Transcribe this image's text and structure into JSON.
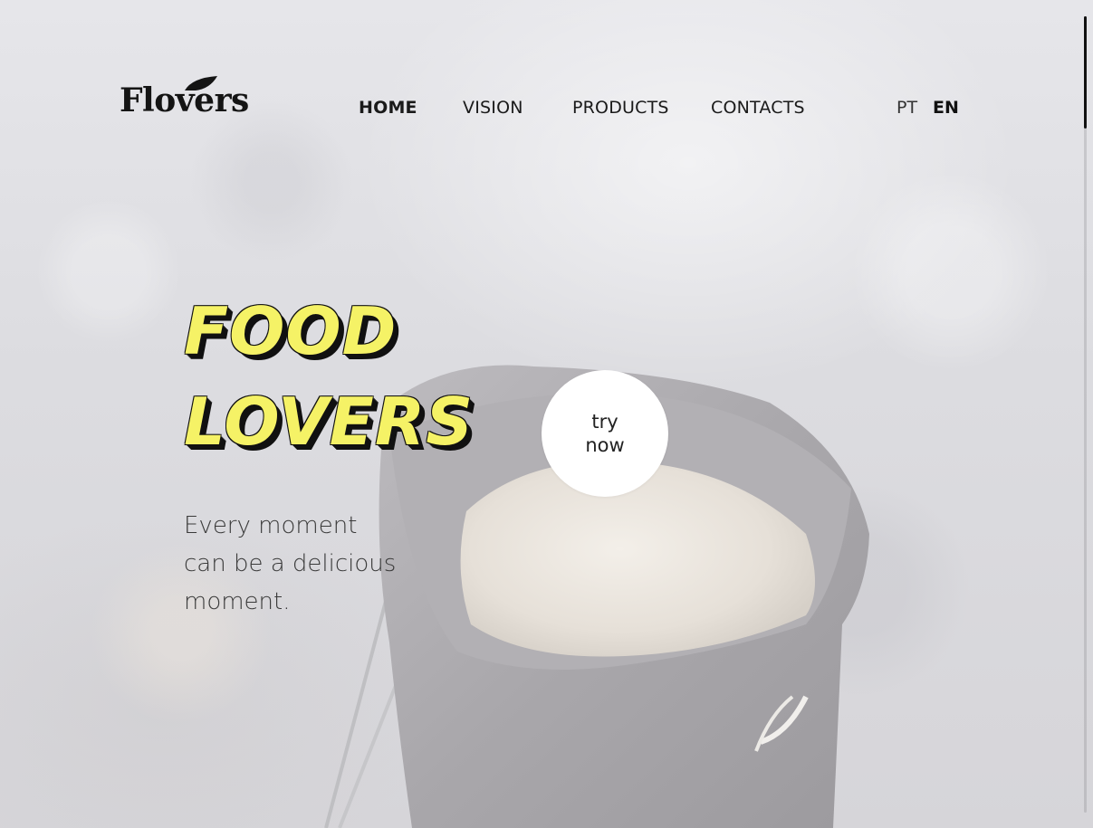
{
  "brand": {
    "logo_text": "Flovers"
  },
  "nav": {
    "items": [
      {
        "label": "HOME",
        "active": true
      },
      {
        "label": "VISION",
        "active": false
      },
      {
        "label": "PRODUCTS",
        "active": false
      },
      {
        "label": "CONTACTS",
        "active": false
      }
    ]
  },
  "languages": [
    {
      "label": "PT",
      "active": false
    },
    {
      "label": "EN",
      "active": true
    }
  ],
  "hero": {
    "headline_line1": "FOOD",
    "headline_line2": "LOVERS",
    "subtext_line1": "Every moment",
    "subtext_line2": "can be a delicious",
    "subtext_line3": "moment.",
    "cta_line1": "try",
    "cta_line2": "now"
  },
  "colors": {
    "headline_fill": "#f5f266",
    "headline_shadow": "#111111",
    "cta_background": "#ffffff",
    "scroll_thumb": "#111111"
  },
  "icons": {
    "logo_mark": "drop-icon"
  }
}
